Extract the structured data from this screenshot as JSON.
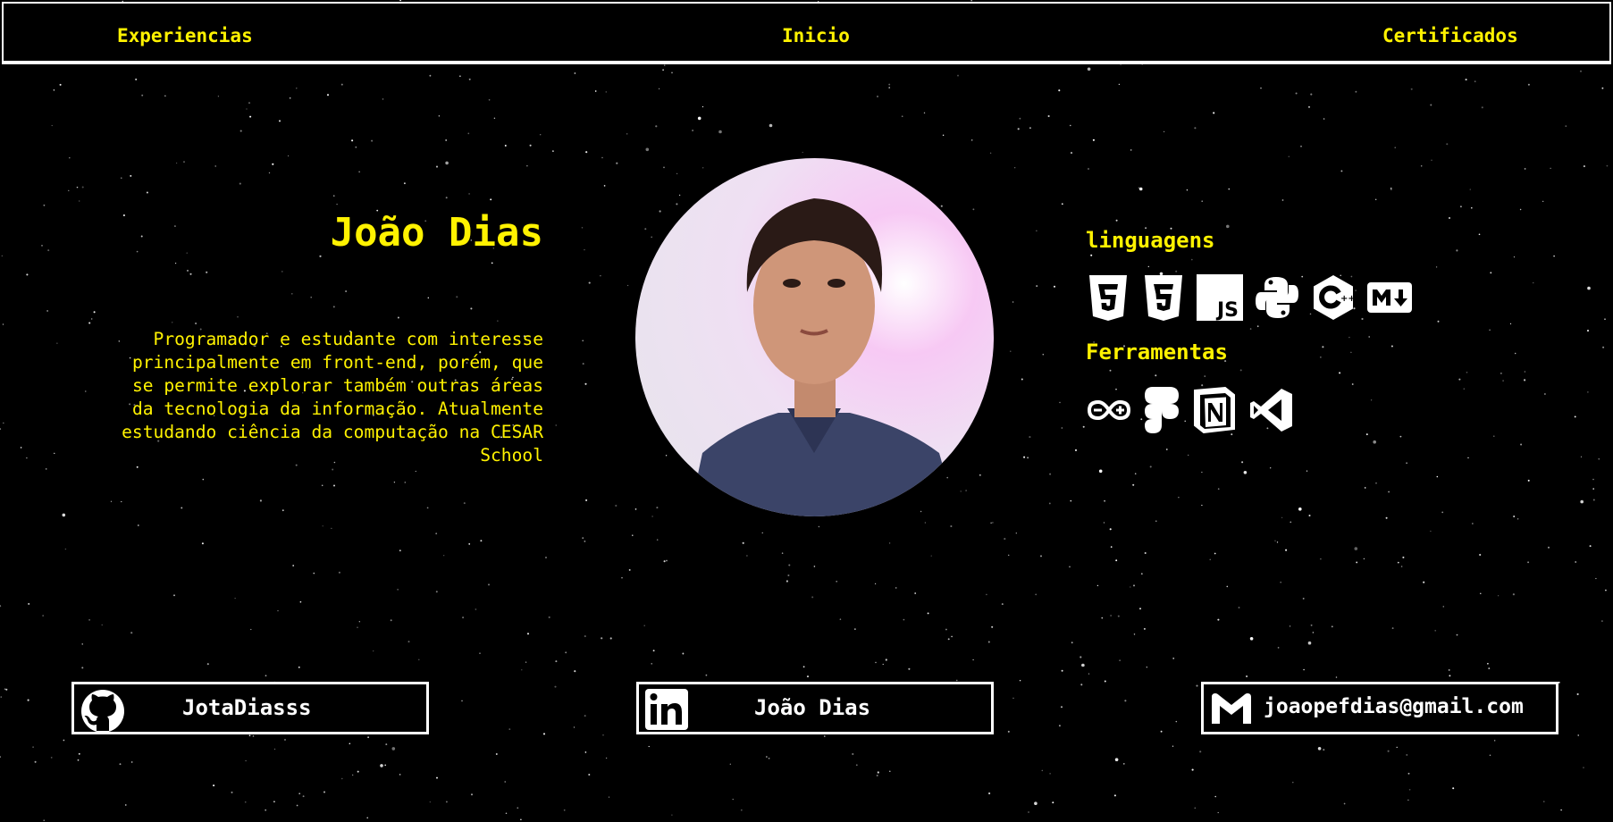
{
  "nav": {
    "left_label": "Experiencias",
    "center_label": "Inicio",
    "right_label": "Certificados"
  },
  "profile": {
    "name": "João Dias",
    "bio": "Programador e estudante com interesse principalmente em front-end, porém, que se permite explorar também outras áreas da tecnologia da informação. Atualmente estudando ciência da computação na CESAR School"
  },
  "skills": {
    "languages_title": "linguagens",
    "languages_icons": [
      "html5-icon",
      "css3-icon",
      "javascript-icon",
      "python-icon",
      "cpp-icon",
      "markdown-icon"
    ],
    "tools_title": "Ferramentas",
    "tools_icons": [
      "arduino-icon",
      "figma-icon",
      "notion-icon",
      "vscode-icon"
    ]
  },
  "contacts": {
    "github": "JotaDiasss",
    "linkedin": "João Dias",
    "email": "joaopefdias@gmail.com"
  },
  "colors": {
    "accent": "#fff200",
    "background": "#000000",
    "foreground": "#ffffff"
  }
}
